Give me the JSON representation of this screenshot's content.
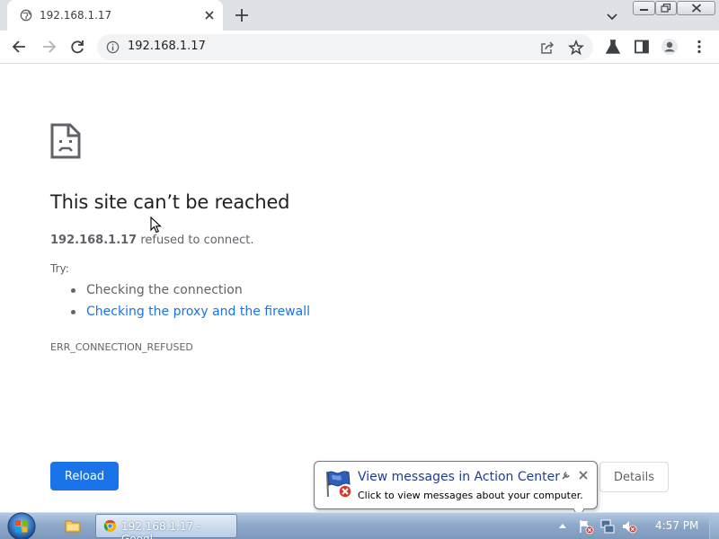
{
  "window": {
    "controls": [
      "minimize",
      "restore",
      "close"
    ]
  },
  "tab": {
    "title": "192.168.1.17",
    "favicon": "globe-icon"
  },
  "toolbar": {
    "url": "192.168.1.17",
    "icons": [
      "back-icon",
      "forward-icon",
      "reload-icon",
      "site-info-icon",
      "share-icon",
      "bookmark-star-icon",
      "labs-flask-icon",
      "side-panel-icon",
      "profile-icon",
      "menu-icon"
    ]
  },
  "error_page": {
    "title": "This site can’t be reached",
    "host": "192.168.1.17",
    "description_suffix": " refused to connect.",
    "try_label": "Try:",
    "suggestions": [
      {
        "text": "Checking the connection",
        "link": false
      },
      {
        "text": "Checking the proxy and the firewall",
        "link": true
      }
    ],
    "error_code": "ERR_CONNECTION_REFUSED",
    "reload_label": "Reload",
    "details_label": "Details",
    "accent_color": "#1a73e8"
  },
  "notification": {
    "title": "View messages in Action Center",
    "text": "Click to view messages about your computer."
  },
  "taskbar": {
    "active_task_label": "192.168.1.17 - Googl...",
    "clock": "4:57 PM"
  }
}
